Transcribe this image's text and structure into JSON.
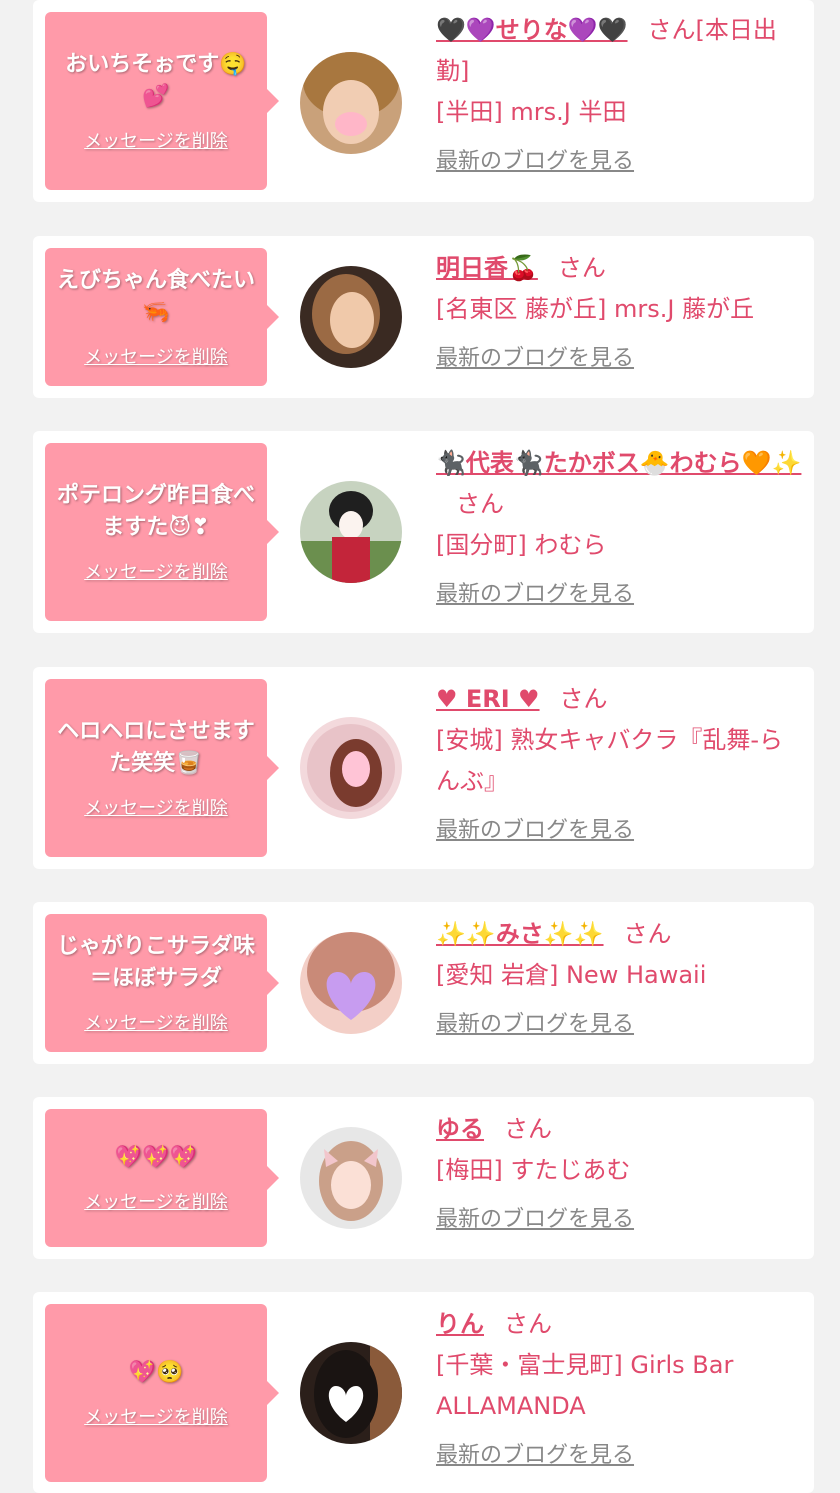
{
  "delete_label": "メッセージを削除",
  "blog_label": "最新のブログを見る",
  "honorific": "さん",
  "colors": {
    "accent": "#e04a6c",
    "bubble": "#ff9aa9",
    "muted": "#888888"
  },
  "messages": [
    {
      "message": "おいちそぉです🤤💕",
      "name": "🖤💜せりな💜🖤",
      "suffix": "[本日出勤]",
      "shop": "[半田] mrs.J 半田",
      "avatar": "blonde-woman-photo"
    },
    {
      "message": "えびちゃん食べたい🦐",
      "name": "明日香🍒",
      "suffix": "",
      "shop": "[名東区 藤が丘] mrs.J 藤が丘",
      "avatar": "woman-profile-photo"
    },
    {
      "message": "ポテロング昨日食べますた😈❣",
      "name": "🐈‍⬛代表🐈‍⬛たかボス🐣わむら🧡✨",
      "suffix": "",
      "shop": "[国分町] わむら",
      "avatar": "geisha-costume-photo"
    },
    {
      "message": "ヘロヘロにさせますた笑笑🥃",
      "name": "♥ ERI ♥",
      "suffix": "",
      "shop": "[安城] 熟女キャバクラ『乱舞-らんぶ』",
      "avatar": "sparkle-frame-photo"
    },
    {
      "message": "じゃがりこサラダ味＝ほぼサラダ",
      "name": "✨✨みさ✨✨",
      "suffix": "",
      "shop": "[愛知 岩倉] New Hawaii",
      "avatar": "heart-covered-face-photo"
    },
    {
      "message": "💖💖💖",
      "name": "ゆる",
      "suffix": "",
      "shop": "[梅田] すたじあむ",
      "avatar": "cat-ears-photo"
    },
    {
      "message": "💖🥺",
      "name": "りん",
      "suffix": "",
      "shop": "[千葉・富士見町] Girls Bar ALLAMANDA",
      "avatar": "dark-hair-photo"
    }
  ]
}
